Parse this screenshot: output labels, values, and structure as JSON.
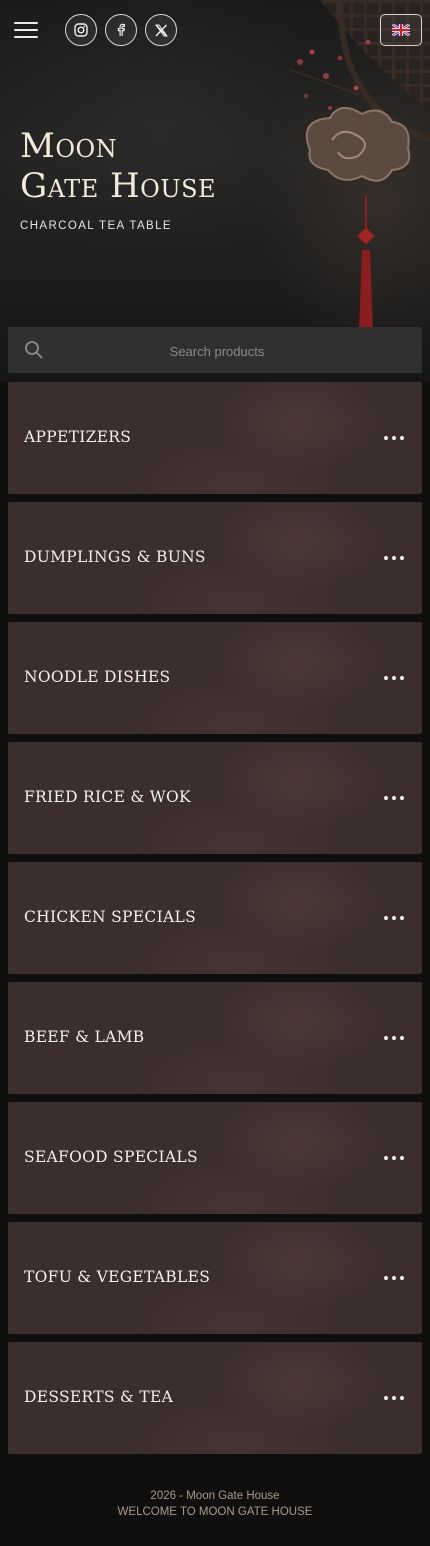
{
  "header": {
    "menu_icon": "hamburger-icon",
    "social": [
      {
        "name": "instagram-icon"
      },
      {
        "name": "facebook-icon"
      },
      {
        "name": "x-icon"
      }
    ],
    "language_icon": "uk-flag-icon"
  },
  "hero": {
    "title_line1": "Moon",
    "title_line2": "Gate House",
    "tagline": "CHARCOAL TEA TABLE"
  },
  "search": {
    "placeholder": "Search products",
    "icon": "search-icon"
  },
  "categories": [
    {
      "label": "APPETIZERS"
    },
    {
      "label": "DUMPLINGS & BUNS"
    },
    {
      "label": "NOODLE DISHES"
    },
    {
      "label": "FRIED RICE & WOK"
    },
    {
      "label": "CHICKEN SPECIALS"
    },
    {
      "label": "BEEF & LAMB"
    },
    {
      "label": "SEAFOOD SPECIALS"
    },
    {
      "label": "TOFU & VEGETABLES"
    },
    {
      "label": "DESSERTS & TEA"
    }
  ],
  "footer": {
    "copyright": "2026 - Moon Gate House",
    "welcome": "WELCOME TO MOON GATE HOUSE"
  },
  "colors": {
    "background": "#0f0f0f",
    "card": "#3d2e2e",
    "search_bar": "#303030",
    "title_text": "#f2ead8",
    "footer_text": "#a89a8a"
  }
}
